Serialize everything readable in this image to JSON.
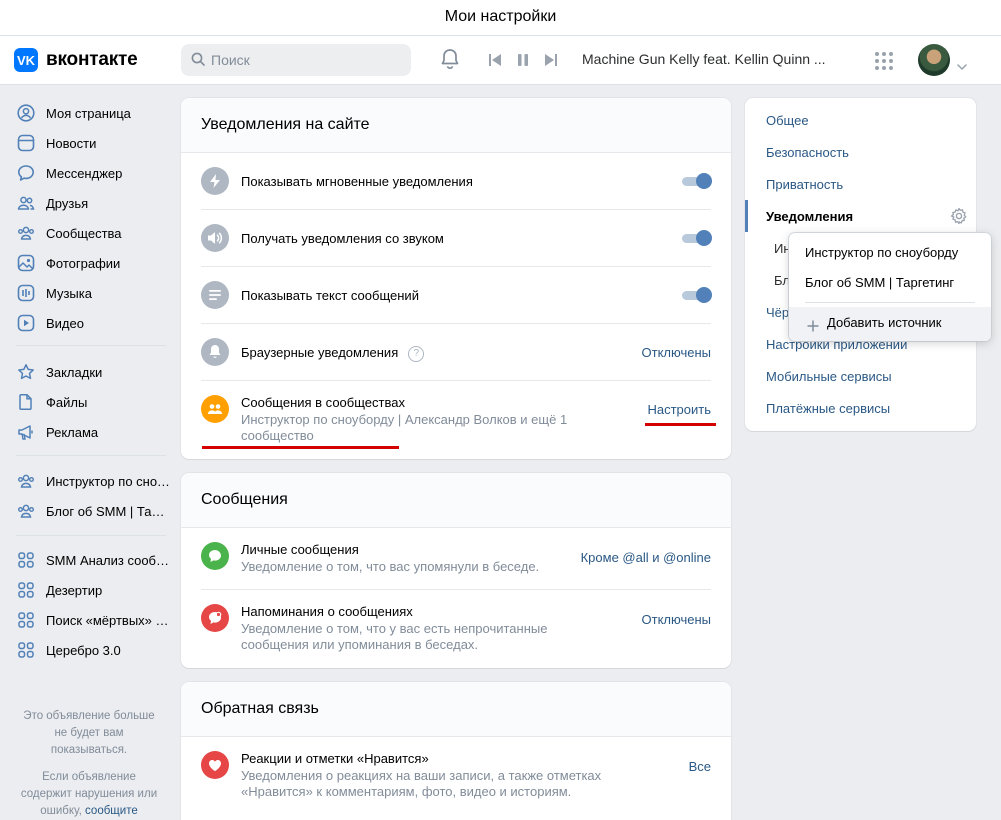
{
  "window": {
    "title": "Мои настройки"
  },
  "header": {
    "logo_text": "вконтакте",
    "logo_letter": "VK",
    "search_placeholder": "Поиск",
    "track": "Machine Gun Kelly feat. Kellin Quinn ..."
  },
  "sidebar": {
    "main": [
      {
        "label": "Моя страница",
        "icon": "user-icon"
      },
      {
        "label": "Новости",
        "icon": "news-icon"
      },
      {
        "label": "Мессенджер",
        "icon": "message-icon"
      },
      {
        "label": "Друзья",
        "icon": "friends-icon"
      },
      {
        "label": "Сообщества",
        "icon": "communities-icon"
      },
      {
        "label": "Фотографии",
        "icon": "photo-icon"
      },
      {
        "label": "Музыка",
        "icon": "music-icon"
      },
      {
        "label": "Видео",
        "icon": "video-icon"
      }
    ],
    "secondary": [
      {
        "label": "Закладки",
        "icon": "star-icon"
      },
      {
        "label": "Файлы",
        "icon": "file-icon"
      },
      {
        "label": "Реклама",
        "icon": "megaphone-icon"
      }
    ],
    "groups": [
      {
        "label": "Инструктор по сноуборду",
        "icon": "group-icon"
      },
      {
        "label": "Блог об SMM | Таргетинг",
        "icon": "group-icon"
      }
    ],
    "apps": [
      {
        "label": "SMM Анализ сообществ",
        "icon": "apps-icon"
      },
      {
        "label": "Дезертир",
        "icon": "apps-icon"
      },
      {
        "label": "Поиск «мёртвых» друзей",
        "icon": "apps-icon"
      },
      {
        "label": "Церебро 3.0",
        "icon": "apps-icon"
      }
    ],
    "ad_note_1": "Это объявление больше не будет вам показываться.",
    "ad_note_2": "Если объявление содержит нарушения или ошибку,",
    "ad_note_link": "сообщите"
  },
  "site_notifications": {
    "title": "Уведомления на сайте",
    "rows": [
      {
        "title": "Показывать мгновенные уведомления",
        "toggle": true,
        "icon": "lightning-icon"
      },
      {
        "title": "Получать уведомления со звуком",
        "toggle": true,
        "icon": "sound-icon"
      },
      {
        "title": "Показывать текст сообщений",
        "toggle": true,
        "icon": "text-icon"
      },
      {
        "title": "Браузерные уведомления",
        "value": "Отключены",
        "icon": "bell-icon"
      },
      {
        "title": "Сообщения в сообществах",
        "subtitle": "Инструктор по сноуборду | Александр Волков и ещё 1 сообщество",
        "value": "Настроить",
        "icon": "community-messages-icon"
      }
    ]
  },
  "messages": {
    "title": "Сообщения",
    "rows": [
      {
        "title": "Личные сообщения",
        "subtitle": "Уведомление о том, что вас упомянули в беседе.",
        "value": "Кроме @all и @online",
        "icon": "chat-icon"
      },
      {
        "title": "Напоминания о сообщениях",
        "subtitle": "Уведомление о том, что у вас есть непрочитанные сообщения или упоминания в беседах.",
        "value": "Отключены",
        "icon": "reminder-icon"
      }
    ]
  },
  "feedback": {
    "title": "Обратная связь",
    "rows": [
      {
        "title": "Реакции и отметки «Нравится»",
        "subtitle": "Уведомления о реакциях на ваши записи, а также отметках «Нравится» к комментариям, фото, видео и историям.",
        "value": "Все",
        "icon": "heart-icon"
      }
    ]
  },
  "settings_menu": {
    "items": [
      {
        "label": "Общее"
      },
      {
        "label": "Безопасность"
      },
      {
        "label": "Приватность"
      },
      {
        "label": "Уведомления",
        "active": true
      },
      {
        "label": "Ин"
      },
      {
        "label": "Бл"
      },
      {
        "label": "Чёр"
      },
      {
        "label": "Настройки приложений"
      },
      {
        "label": "Мобильные сервисы"
      },
      {
        "label": "Платёжные сервисы"
      }
    ]
  },
  "source_dropdown": {
    "items": [
      {
        "label": "Инструктор по сноуборду"
      },
      {
        "label": "Блог об SMM | Таргетинг"
      }
    ],
    "add_label": "Добавить источник"
  },
  "colors": {
    "accent": "#5181b8",
    "link": "#2a5885",
    "highlight": "#d40000",
    "brand": "#0077ff"
  }
}
